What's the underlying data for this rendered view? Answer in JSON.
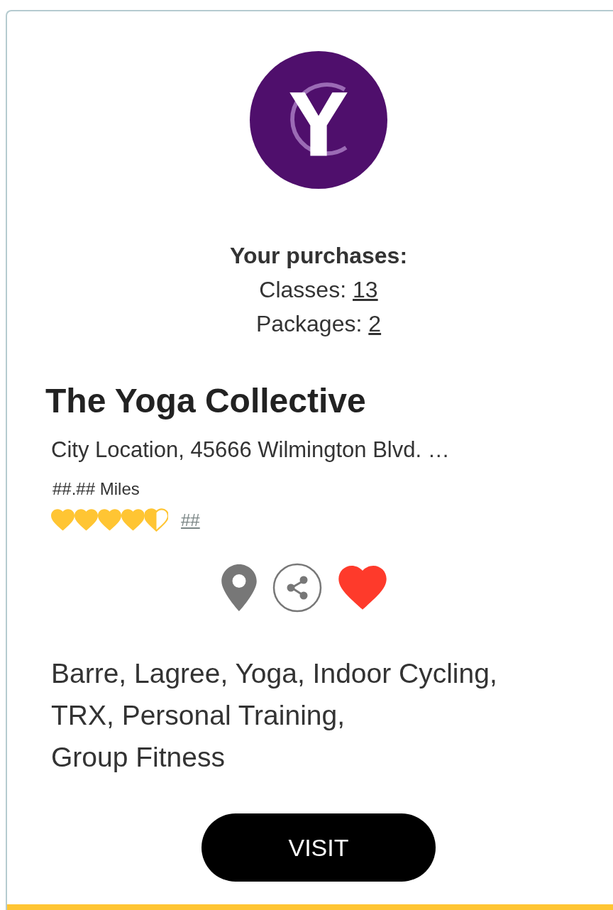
{
  "purchases": {
    "heading": "Your purchases:",
    "items": [
      {
        "label": "Classes:",
        "count": "13"
      },
      {
        "label": "Packages:",
        "count": "2"
      }
    ]
  },
  "studio": {
    "name": "The Yoga Collective",
    "address": "City Location, 45666 Wilmington Blvd. …",
    "distance": "##.## Miles",
    "stars": 4.5,
    "review_count": "##",
    "favorited": true,
    "categories": [
      "Barre, Lagree, Yoga, Indoor Cycling,",
      "TRX, Personal Training,",
      "Group Fitness"
    ]
  },
  "button": "VISIT"
}
